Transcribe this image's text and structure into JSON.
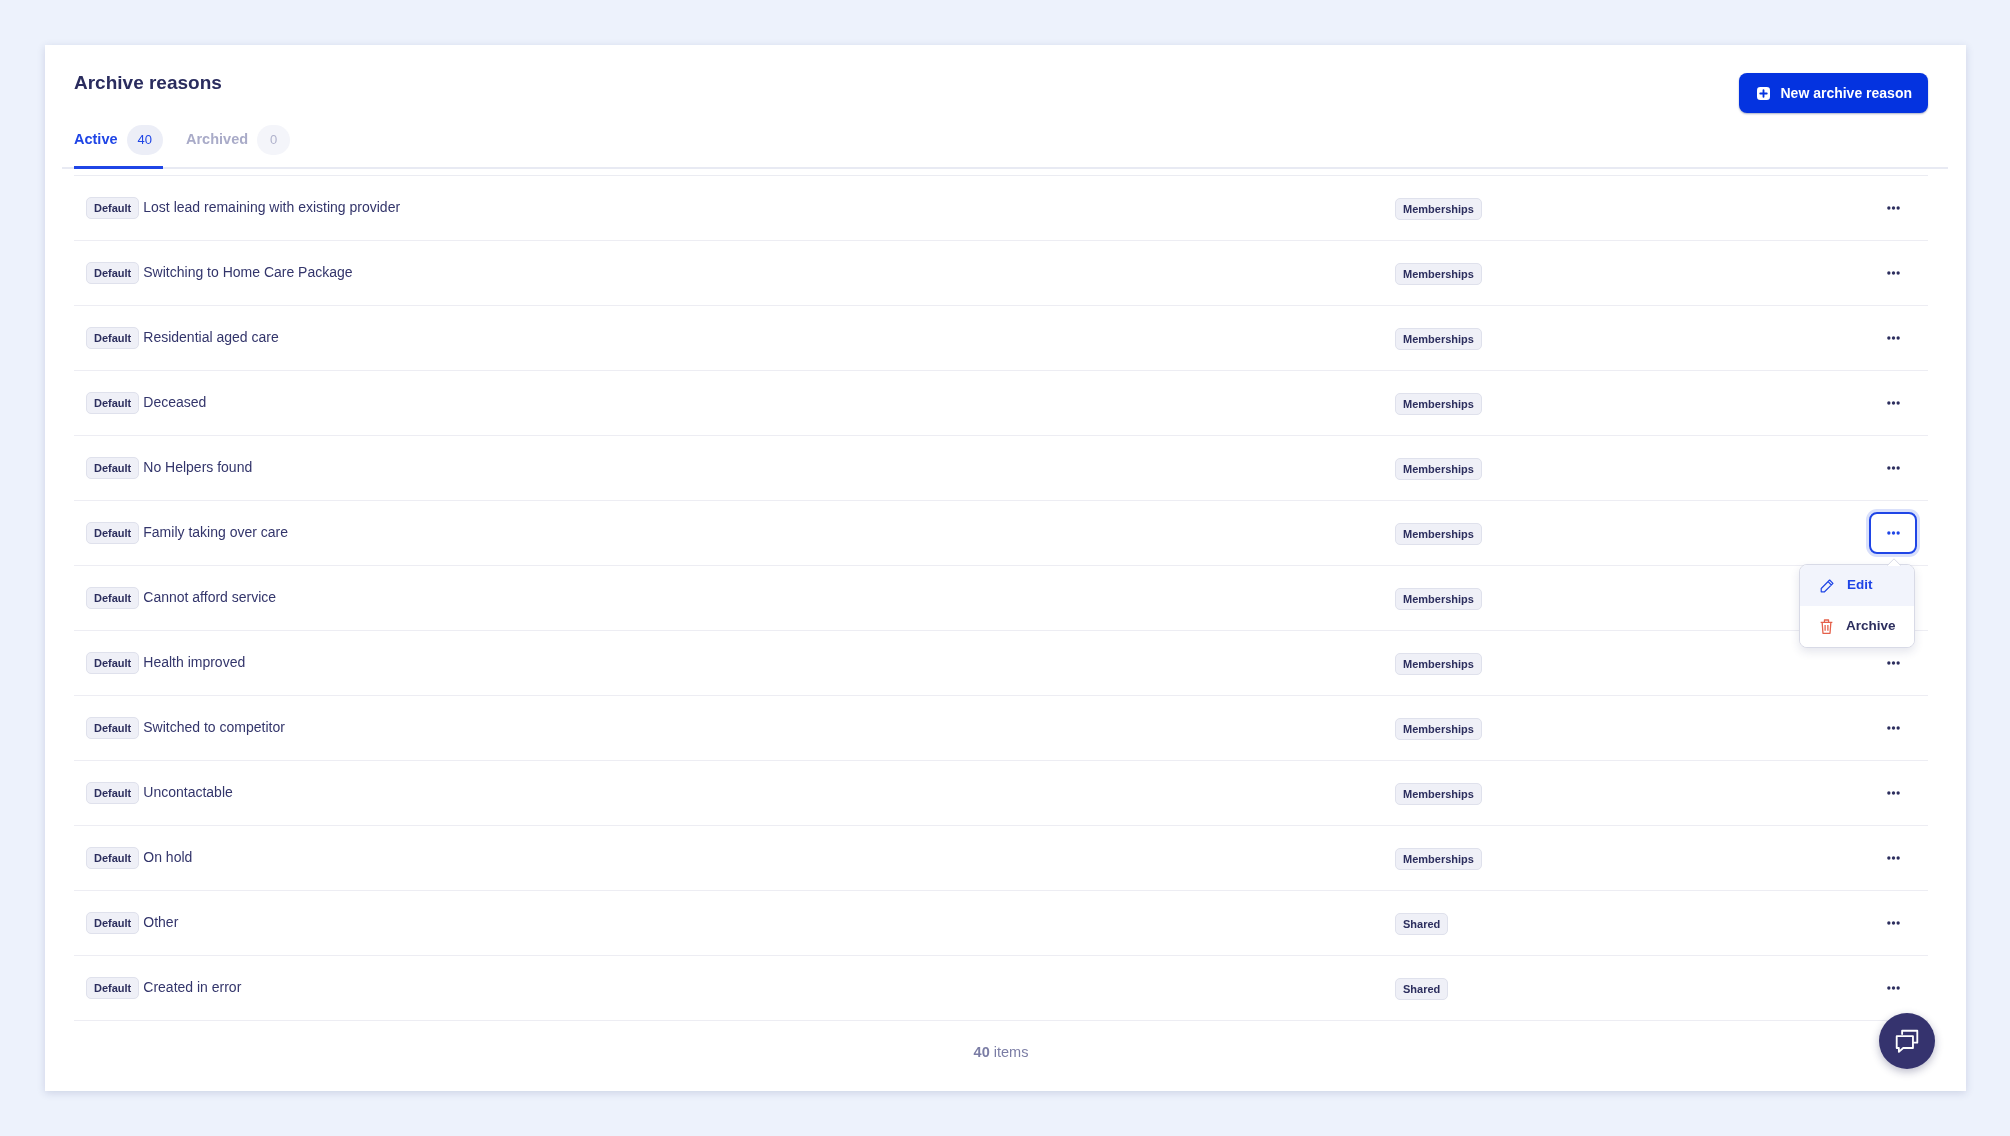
{
  "page": {
    "title": "Archive reasons",
    "new_button": "New archive reason"
  },
  "tabs": [
    {
      "label": "Active",
      "count": "40",
      "selected": true
    },
    {
      "label": "Archived",
      "count": "0",
      "selected": false
    }
  ],
  "rows": [
    {
      "tag": "Default",
      "name": "Lost lead remaining with existing provider",
      "category": "Memberships",
      "menu_open": false
    },
    {
      "tag": "Default",
      "name": "Switching to Home Care Package",
      "category": "Memberships",
      "menu_open": false
    },
    {
      "tag": "Default",
      "name": "Residential aged care",
      "category": "Memberships",
      "menu_open": false
    },
    {
      "tag": "Default",
      "name": "Deceased",
      "category": "Memberships",
      "menu_open": false
    },
    {
      "tag": "Default",
      "name": "No Helpers found",
      "category": "Memberships",
      "menu_open": false
    },
    {
      "tag": "Default",
      "name": "Family taking over care",
      "category": "Memberships",
      "menu_open": true
    },
    {
      "tag": "Default",
      "name": "Cannot afford service",
      "category": "Memberships",
      "menu_open": false
    },
    {
      "tag": "Default",
      "name": "Health improved",
      "category": "Memberships",
      "menu_open": false
    },
    {
      "tag": "Default",
      "name": "Switched to competitor",
      "category": "Memberships",
      "menu_open": false
    },
    {
      "tag": "Default",
      "name": "Uncontactable",
      "category": "Memberships",
      "menu_open": false
    },
    {
      "tag": "Default",
      "name": "On hold",
      "category": "Memberships",
      "menu_open": false
    },
    {
      "tag": "Default",
      "name": "Other",
      "category": "Shared",
      "menu_open": false
    },
    {
      "tag": "Default",
      "name": "Created in error",
      "category": "Shared",
      "menu_open": false
    }
  ],
  "row_menu": {
    "items": [
      {
        "kind": "edit",
        "label": "Edit",
        "highlighted": true
      },
      {
        "kind": "archive",
        "label": "Archive",
        "highlighted": false
      }
    ]
  },
  "footer": {
    "count_text": "**40** items"
  }
}
